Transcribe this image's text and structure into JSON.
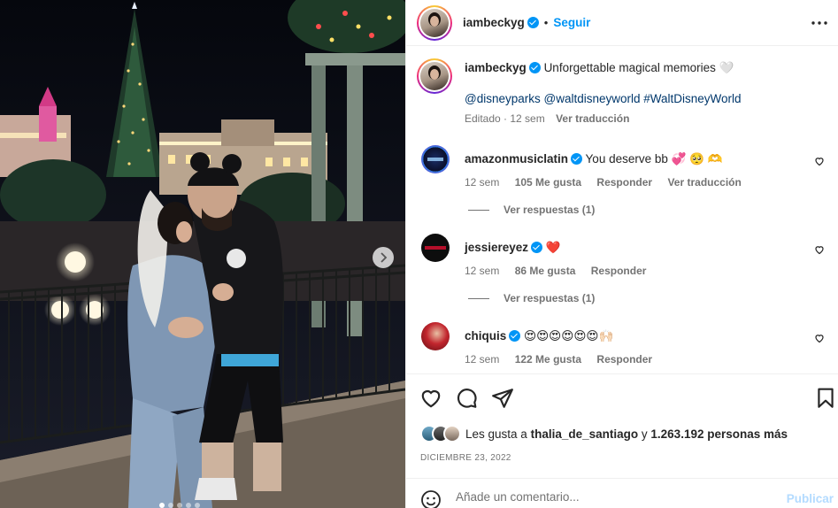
{
  "post": {
    "author": "iambeckyg",
    "follow_separator": "•",
    "follow_label": "Seguir",
    "media": {
      "slides": 5,
      "active_slide": 1
    }
  },
  "caption": {
    "author": "iambeckyg",
    "text": "Unforgettable magical memories 🤍",
    "tags": "@disneyparks @waltdisneyworld #WaltDisneyWorld",
    "edited": "Editado · 12 sem",
    "translate": "Ver traducción"
  },
  "comments": [
    {
      "user": "amazonmusiclatin",
      "text": "You deserve bb 💞 🥺 🫶",
      "time": "12 sem",
      "likes": "105 Me gusta",
      "reply": "Responder",
      "translate": "Ver traducción",
      "replies": "Ver respuestas (1)"
    },
    {
      "user": "jessiereyez",
      "text": "❤️",
      "time": "12 sem",
      "likes": "86 Me gusta",
      "reply": "Responder",
      "replies": "Ver respuestas (1)"
    },
    {
      "user": "chiquis",
      "text": "😍😍😍😍😍😍🙌🏻",
      "time": "12 sem",
      "likes": "122 Me gusta",
      "reply": "Responder"
    }
  ],
  "likes": {
    "prefix": "Les gusta a",
    "liker": "thalia_de_santiago",
    "connector": "y",
    "others": "1.263.192 personas más"
  },
  "date": "DICIEMBRE 23, 2022",
  "composer": {
    "placeholder": "Añade un comentario...",
    "publish": "Publicar"
  },
  "colors": {
    "accent": "#0095f6",
    "link": "#00376b",
    "muted": "#737373",
    "publish_disabled": "#b3dbff"
  }
}
